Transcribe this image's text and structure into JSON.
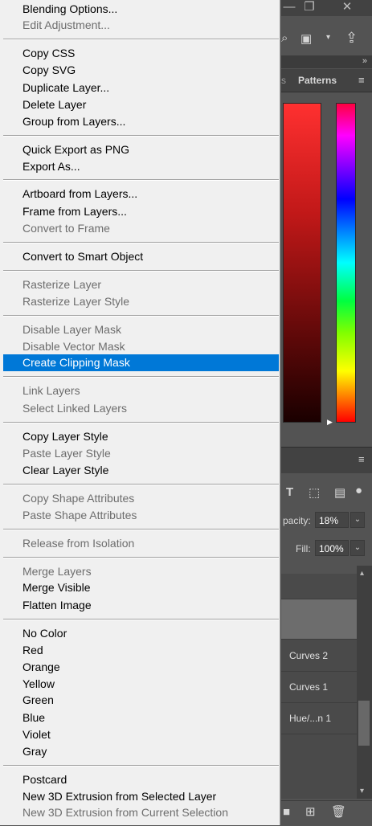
{
  "menu": {
    "items": [
      {
        "label": "Blending Options...",
        "enabled": true
      },
      {
        "label": "Edit Adjustment...",
        "enabled": false
      },
      {
        "label": "Copy CSS",
        "enabled": true
      },
      {
        "label": "Copy SVG",
        "enabled": true
      },
      {
        "label": "Duplicate Layer...",
        "enabled": true
      },
      {
        "label": "Delete Layer",
        "enabled": true
      },
      {
        "label": "Group from Layers...",
        "enabled": true
      },
      {
        "label": "Quick Export as PNG",
        "enabled": true
      },
      {
        "label": "Export As...",
        "enabled": true
      },
      {
        "label": "Artboard from Layers...",
        "enabled": true
      },
      {
        "label": "Frame from Layers...",
        "enabled": true
      },
      {
        "label": "Convert to Frame",
        "enabled": false
      },
      {
        "label": "Convert to Smart Object",
        "enabled": true
      },
      {
        "label": "Rasterize Layer",
        "enabled": false
      },
      {
        "label": "Rasterize Layer Style",
        "enabled": false
      },
      {
        "label": "Disable Layer Mask",
        "enabled": false
      },
      {
        "label": "Disable Vector Mask",
        "enabled": false
      },
      {
        "label": "Create Clipping Mask",
        "enabled": true,
        "highlighted": true
      },
      {
        "label": "Link Layers",
        "enabled": false
      },
      {
        "label": "Select Linked Layers",
        "enabled": false
      },
      {
        "label": "Copy Layer Style",
        "enabled": true
      },
      {
        "label": "Paste Layer Style",
        "enabled": false
      },
      {
        "label": "Clear Layer Style",
        "enabled": true
      },
      {
        "label": "Copy Shape Attributes",
        "enabled": false
      },
      {
        "label": "Paste Shape Attributes",
        "enabled": false
      },
      {
        "label": "Release from Isolation",
        "enabled": false
      },
      {
        "label": "Merge Layers",
        "enabled": false
      },
      {
        "label": "Merge Visible",
        "enabled": true
      },
      {
        "label": "Flatten Image",
        "enabled": true
      },
      {
        "label": "No Color",
        "enabled": true
      },
      {
        "label": "Red",
        "enabled": true
      },
      {
        "label": "Orange",
        "enabled": true
      },
      {
        "label": "Yellow",
        "enabled": true
      },
      {
        "label": "Green",
        "enabled": true
      },
      {
        "label": "Blue",
        "enabled": true
      },
      {
        "label": "Violet",
        "enabled": true
      },
      {
        "label": "Gray",
        "enabled": true
      },
      {
        "label": "Postcard",
        "enabled": true
      },
      {
        "label": "New 3D Extrusion from Selected Layer",
        "enabled": true
      },
      {
        "label": "New 3D Extrusion from Current Selection",
        "enabled": false
      }
    ],
    "highlight_color": "#0078d7"
  },
  "panel": {
    "tab_partial": "s",
    "tab_patterns": "Patterns",
    "opacity_label": "pacity:",
    "opacity_value": "18%",
    "fill_label": "Fill:",
    "fill_value": "100%",
    "layers": [
      {
        "name": ""
      },
      {
        "name": "Curves 2"
      },
      {
        "name": "Curves 1"
      },
      {
        "name": "Hue/...n 1"
      }
    ]
  },
  "icons": [
    "minimize-icon",
    "restore-icon",
    "close-icon",
    "search-icon",
    "workspace-icon",
    "chevron-down-icon",
    "share-icon",
    "double-chevron-icon",
    "panel-menu-icon",
    "type-layer-icon",
    "transform-icon",
    "smart-object-icon",
    "lock-icon",
    "new-layer-icon",
    "add-layer-icon",
    "delete-icon"
  ]
}
